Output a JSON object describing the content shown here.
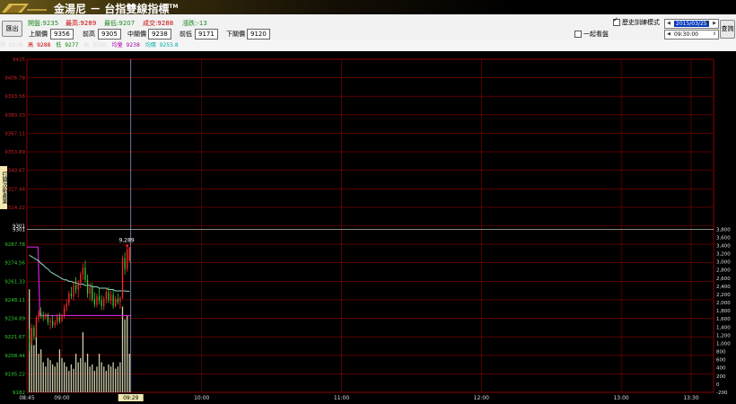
{
  "app": {
    "title": "金湯尼 － 台指雙線指標",
    "trademark": "TM"
  },
  "header": {
    "exit_label": "匯出",
    "stats": [
      {
        "label": "開盤:",
        "value": "9235",
        "color": "green"
      },
      {
        "label": "最高:",
        "value": "9289",
        "color": "red"
      },
      {
        "label": "最低:",
        "value": "9207",
        "color": "green"
      },
      {
        "label": "成交:",
        "value": "9288",
        "color": "red"
      },
      {
        "label": "漲跌:",
        "value": "-13",
        "color": "green"
      }
    ],
    "prices": [
      {
        "label": "上關價",
        "value": "9356"
      },
      {
        "label": "前高",
        "value": "9305"
      },
      {
        "label": "中關價",
        "value": "9238"
      },
      {
        "label": "前低",
        "value": "9171"
      },
      {
        "label": "下關價",
        "value": "9120"
      }
    ],
    "history_mode_label": "歷史訓練模式",
    "together_label": "一起看盤",
    "date_value": "2015/03/25",
    "time_value": "09:30:00",
    "query_label": "查詢"
  },
  "ohlc_strip": [
    {
      "label": "開",
      "value": "9278",
      "color": "#000"
    },
    {
      "label": "高",
      "value": "9288",
      "color": "#c00"
    },
    {
      "label": "低",
      "value": "9277",
      "color": "#080"
    },
    {
      "label": "收",
      "value": "9288",
      "color": "#000"
    },
    {
      "label": "均量",
      "value": "9238",
      "color": "#a0a"
    },
    {
      "label": "均價",
      "value": "9255.8",
      "color": "#0aa"
    }
  ],
  "side_tab_label": "打開次新產業",
  "colors": {
    "grid": "#8b0000",
    "up": "#ff2a2a",
    "down": "#33cc33",
    "avg_price": "#88ddcc",
    "magenta": "#cc22cc",
    "volume": "#ccccaa",
    "cursor": "#9ad"
  },
  "chart_data": {
    "type": "candlestick",
    "price_axis": {
      "ticks": [
        "9425",
        "9406.78",
        "9393.56",
        "9380.33",
        "9367.11",
        "9353.89",
        "9340.67",
        "9327.44",
        "9314.22",
        "9301",
        "9287.78",
        "9274.56",
        "9261.33",
        "9248.11",
        "9234.89",
        "9221.67",
        "9208.44",
        "9195.22",
        "9182"
      ],
      "upper_tick_color": "#cc2222",
      "lower_tick_color": "#33cc33",
      "range": [
        9182,
        9425
      ]
    },
    "volume_axis": {
      "ticks": [
        "3,800",
        "3,600",
        "3,400",
        "3,200",
        "3,000",
        "2,800",
        "2,600",
        "2,400",
        "2,200",
        "2,000",
        "1,800",
        "1,600",
        "1,400",
        "1,200",
        "1,000",
        "800",
        "600",
        "400",
        "200",
        "0",
        "-200"
      ],
      "range": [
        -200,
        3800
      ]
    },
    "time_labels": [
      {
        "label": "08:45",
        "minute": 0
      },
      {
        "label": "09:00",
        "minute": 15
      },
      {
        "label": "10:00",
        "minute": 75
      },
      {
        "label": "11:00",
        "minute": 135
      },
      {
        "label": "12:00",
        "minute": 195
      },
      {
        "label": "13:00",
        "minute": 255
      },
      {
        "label": "13:30",
        "minute": 285
      }
    ],
    "cursor_label": "09:29",
    "cursor_minute": 44,
    "last_label": "9,289",
    "reference_price": 9301,
    "candles": [
      [
        9222,
        9228,
        9212,
        9218
      ],
      [
        9218,
        9232,
        9216,
        9229
      ],
      [
        9229,
        9231,
        9220,
        9223
      ],
      [
        9223,
        9238,
        9222,
        9236
      ],
      [
        9236,
        9242,
        9233,
        9240
      ],
      [
        9240,
        9244,
        9236,
        9238
      ],
      [
        9238,
        9241,
        9234,
        9237
      ],
      [
        9237,
        9240,
        9235,
        9239
      ],
      [
        9239,
        9240,
        9231,
        9233
      ],
      [
        9233,
        9236,
        9228,
        9234
      ],
      [
        9234,
        9238,
        9229,
        9231
      ],
      [
        9231,
        9235,
        9229,
        9233
      ],
      [
        9233,
        9239,
        9231,
        9237
      ],
      [
        9237,
        9240,
        9232,
        9234
      ],
      [
        9234,
        9239,
        9233,
        9238
      ],
      [
        9238,
        9246,
        9236,
        9244
      ],
      [
        9244,
        9250,
        9241,
        9247
      ],
      [
        9247,
        9256,
        9245,
        9254
      ],
      [
        9254,
        9259,
        9250,
        9252
      ],
      [
        9252,
        9262,
        9249,
        9260
      ],
      [
        9260,
        9266,
        9254,
        9257
      ],
      [
        9257,
        9264,
        9251,
        9262
      ],
      [
        9262,
        9270,
        9258,
        9268
      ],
      [
        9268,
        9276,
        9264,
        9273
      ],
      [
        9273,
        9278,
        9262,
        9264
      ],
      [
        9264,
        9268,
        9251,
        9254
      ],
      [
        9254,
        9262,
        9249,
        9259
      ],
      [
        9259,
        9262,
        9248,
        9250
      ],
      [
        9250,
        9255,
        9244,
        9246
      ],
      [
        9246,
        9254,
        9244,
        9252
      ],
      [
        9252,
        9258,
        9246,
        9249
      ],
      [
        9249,
        9253,
        9242,
        9245
      ],
      [
        9245,
        9252,
        9242,
        9250
      ],
      [
        9250,
        9258,
        9247,
        9255
      ],
      [
        9255,
        9259,
        9247,
        9249
      ],
      [
        9249,
        9256,
        9246,
        9253
      ],
      [
        9253,
        9257,
        9243,
        9245
      ],
      [
        9245,
        9252,
        9244,
        9250
      ],
      [
        9250,
        9254,
        9246,
        9248
      ],
      [
        9248,
        9252,
        9243,
        9251
      ],
      [
        9251,
        9282,
        9250,
        9280
      ],
      [
        9280,
        9284,
        9268,
        9272
      ],
      [
        9272,
        9289,
        9270,
        9286
      ],
      [
        9278,
        9288,
        9277,
        9288
      ]
    ],
    "avg_price_line": [
      9282,
      9281,
      9280,
      9279,
      9278,
      9276,
      9275,
      9273,
      9272,
      9270,
      9269,
      9268,
      9267,
      9266,
      9265,
      9264,
      9264,
      9263,
      9263,
      9262,
      9262,
      9261,
      9261,
      9261,
      9260,
      9260,
      9260,
      9259,
      9259,
      9259,
      9258,
      9258,
      9258,
      9258,
      9257,
      9257,
      9257,
      9256,
      9256,
      9256,
      9256,
      9256,
      9255.8,
      9255.8
    ],
    "magenta_line": {
      "upper": 9288,
      "lower": 9238,
      "step_minute": 4
    },
    "volumes": [
      2400,
      1500,
      1100,
      1300,
      900,
      1000,
      700,
      600,
      800,
      750,
      650,
      600,
      700,
      1000,
      800,
      700,
      600,
      500,
      650,
      550,
      900,
      700,
      800,
      1400,
      700,
      900,
      600,
      650,
      500,
      600,
      900,
      700,
      600,
      500,
      650,
      600,
      700,
      550,
      600,
      700,
      2000,
      1700,
      1800,
      900
    ]
  }
}
